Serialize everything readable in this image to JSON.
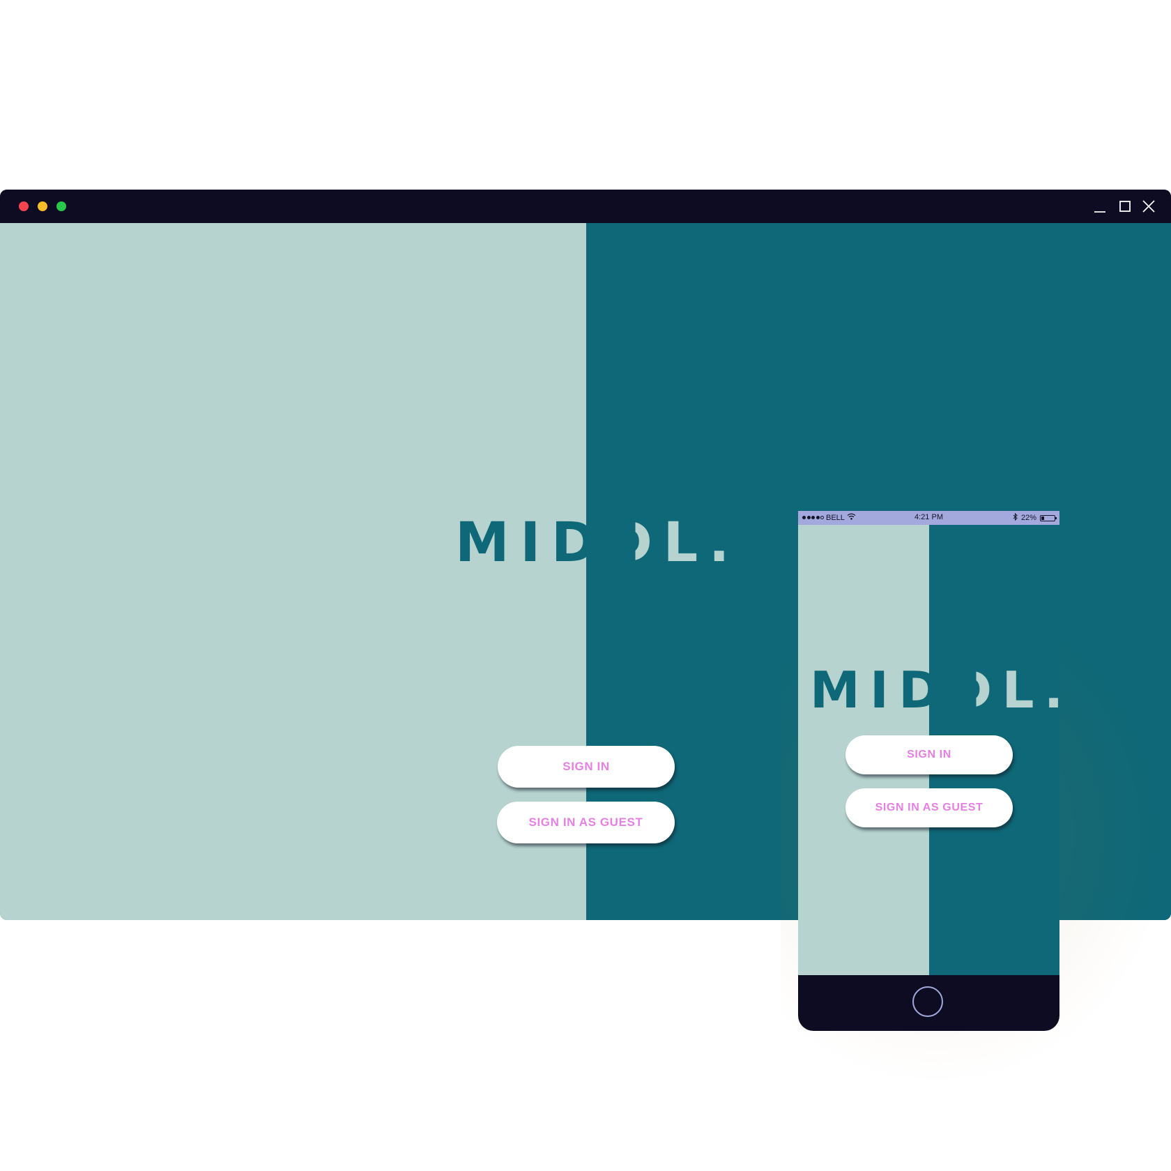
{
  "colors": {
    "light_teal": "#b6d3cf",
    "dark_teal": "#0e6877",
    "frame": "#0e0c22",
    "button_text": "#e57fe3",
    "status_bar": "#a3a9dc"
  },
  "desktop": {
    "window_controls": {
      "close_dot": "#f5444f",
      "minimize_dot": "#f7bd2b",
      "zoom_dot": "#29c84a",
      "icons": [
        "minimize-icon",
        "maximize-icon",
        "close-icon"
      ]
    },
    "logo": {
      "part1": "MID",
      "part2": "D",
      "part3": "L."
    },
    "buttons": {
      "sign_in": "SIGN IN",
      "sign_in_guest": "SIGN IN AS GUEST"
    }
  },
  "phone": {
    "status_bar": {
      "carrier": "BELL",
      "time": "4:21 PM",
      "battery": "22%",
      "battery_level": 0.22,
      "icons": [
        "signal-dots-icon",
        "wifi-icon",
        "bluetooth-icon",
        "battery-icon"
      ]
    },
    "logo": {
      "part1": "MID",
      "part2": "D",
      "part3": "L."
    },
    "buttons": {
      "sign_in": "SIGN IN",
      "sign_in_guest": "SIGN IN AS GUEST"
    }
  }
}
